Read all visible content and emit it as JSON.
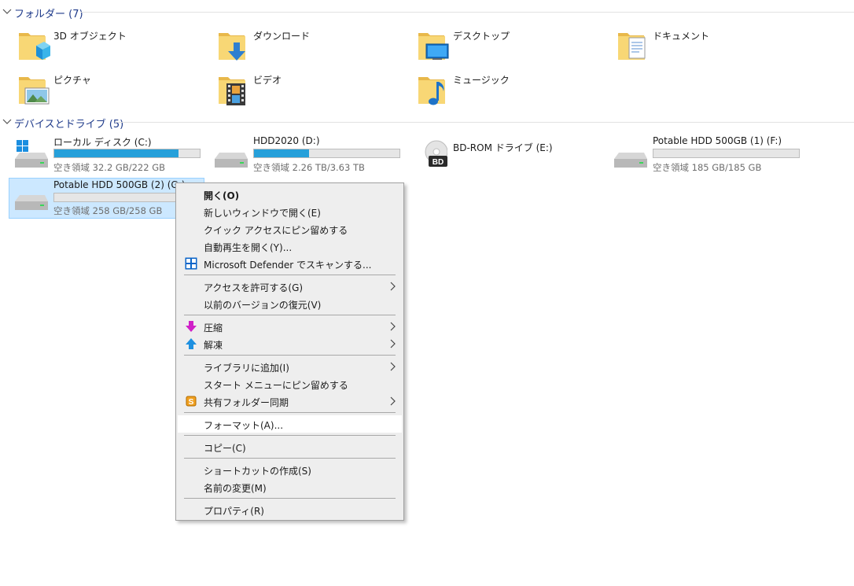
{
  "folders_group": {
    "title": "フォルダー (7)",
    "items": [
      {
        "name": "3D オブジェクト",
        "icon": "3d-objects-folder-icon"
      },
      {
        "name": "ダウンロード",
        "icon": "downloads-folder-icon"
      },
      {
        "name": "デスクトップ",
        "icon": "desktop-folder-icon"
      },
      {
        "name": "ドキュメント",
        "icon": "documents-folder-icon"
      },
      {
        "name": "ピクチャ",
        "icon": "pictures-folder-icon"
      },
      {
        "name": "ビデオ",
        "icon": "videos-folder-icon"
      },
      {
        "name": "ミュージック",
        "icon": "music-folder-icon"
      }
    ]
  },
  "drives_group": {
    "title": "デバイスとドライブ (5)",
    "items": [
      {
        "name": "ローカル ディスク (C:)",
        "space": "空き領域 32.2 GB/222 GB",
        "used_fraction": 0.855,
        "icon": "windows-drive-icon"
      },
      {
        "name": "HDD2020 (D:)",
        "space": "空き領域 2.26 TB/3.63 TB",
        "used_fraction": 0.377,
        "icon": "hard-drive-icon"
      },
      {
        "name": "BD-ROM ドライブ (E:)",
        "icon": "bd-rom-drive-icon"
      },
      {
        "name": "Potable HDD 500GB (1) (F:)",
        "space": "空き領域 185 GB/185 GB",
        "used_fraction": 0.0,
        "icon": "hard-drive-icon"
      },
      {
        "name": "Potable HDD 500GB (2) (G:)",
        "space": "空き領域 258 GB/258 GB",
        "used_fraction": 0.0,
        "icon": "hard-drive-icon",
        "selected": true
      }
    ]
  },
  "context_menu": {
    "items": [
      {
        "label": "開く(O)",
        "bold": true
      },
      {
        "label": "新しいウィンドウで開く(E)"
      },
      {
        "label": "クイック アクセスにピン留めする"
      },
      {
        "label": "自動再生を開く(Y)..."
      },
      {
        "label": "Microsoft Defender でスキャンする...",
        "icon": "defender-shield-icon"
      },
      {
        "label": "アクセスを許可する(G)",
        "submenu": true
      },
      {
        "label": "以前のバージョンの復元(V)"
      },
      {
        "label": "圧縮",
        "icon": "compress-arrow-icon",
        "submenu": true
      },
      {
        "label": "解凍",
        "icon": "extract-arrow-icon",
        "submenu": true
      },
      {
        "label": "ライブラリに追加(I)",
        "submenu": true
      },
      {
        "label": "スタート メニューにピン留めする"
      },
      {
        "label": "共有フォルダー同期",
        "icon": "sync-s-icon",
        "submenu": true
      },
      {
        "label": "フォーマット(A)...",
        "hover": true
      },
      {
        "label": "コピー(C)"
      },
      {
        "label": "ショートカットの作成(S)"
      },
      {
        "label": "名前の変更(M)"
      },
      {
        "label": "プロパティ(R)"
      }
    ]
  },
  "colors": {
    "accent_bar": "#26a0da",
    "selection_bg": "#cce8ff",
    "group_header_text": "#1e3a8a"
  }
}
